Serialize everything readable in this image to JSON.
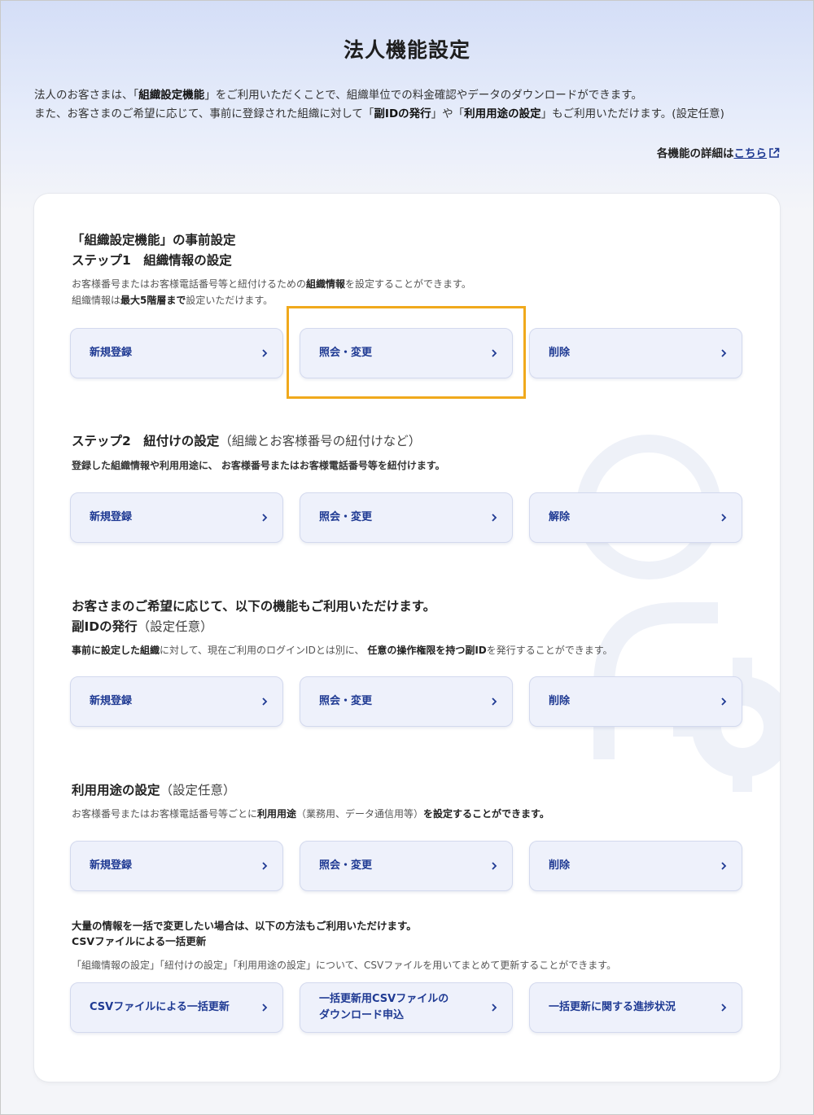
{
  "page": {
    "title": "法人機能設定",
    "intro": {
      "l1a": "法人のお客さまは、「",
      "l1b": "組織設定機能",
      "l1c": "」をご利用いただくことで、組織単位での料金確認やデータのダウンロードができます。",
      "l2a": "また、お客さまのご希望に応じて、事前に登録された組織に対して「",
      "l2b": "副IDの発行",
      "l2c": "」や「",
      "l2d": "利用用途の設定",
      "l2e": "」もご利用いただけます。(設定任意)"
    },
    "detail": {
      "text": "各機能の詳細は",
      "link": "こちら",
      "icon": "external-link-icon"
    }
  },
  "colors": {
    "accent": "#1f3a93",
    "button_bg": "#eef1fb",
    "highlight": "#f0a91c"
  },
  "sections": {
    "step1": {
      "pre": "「組織設定機能」の事前設定",
      "heading": "ステップ1　組織情報の設定",
      "d1a": "お客様番号またはお客様電話番号等と紐付けるための",
      "d1b": "組織情報",
      "d1c": "を設定することができます。",
      "d2a": "組織情報は",
      "d2b": "最大5階層まで",
      "d2c": "設定いただけます。",
      "buttons": [
        "新規登録",
        "照会・変更",
        "削除"
      ]
    },
    "step2": {
      "heading": "ステップ2　紐付けの設定",
      "sub": "（組織とお客様番号の紐付けなど）",
      "desc": "登録した組織情報や利用用途に、 お客様番号またはお客様電話番号等を紐付けます。",
      "buttons": [
        "新規登録",
        "照会・変更",
        "解除"
      ]
    },
    "subid": {
      "pre": "お客さまのご希望に応じて、以下の機能もご利用いただけます。",
      "heading": "副IDの発行",
      "sub": "（設定任意）",
      "da": "事前に設定した組織",
      "db": "に対して、現在ご利用のログインIDとは別に、",
      "dc": "任意の操作権限を持つ副ID",
      "dd": "を発行することができます。",
      "buttons": [
        "新規登録",
        "照会・変更",
        "削除"
      ]
    },
    "usage": {
      "heading": "利用用途の設定",
      "sub": "（設定任意）",
      "da": "お客様番号またはお客様電話番号等ごとに",
      "db": "利用用途",
      "dc": "（業務用、データ通信用等）",
      "dd": "を設定することができます。",
      "buttons": [
        "新規登録",
        "照会・変更",
        "削除"
      ]
    },
    "csv": {
      "pre": "大量の情報を一括で変更したい場合は、以下の方法もご利用いただけます。",
      "heading": "CSVファイルによる一括更新",
      "desc": "「組織情報の設定」「紐付けの設定」「利用用途の設定」について、CSVファイルを用いてまとめて更新することができます。",
      "buttons": [
        "CSVファイルによる一括更新",
        "一括更新用CSVファイルの\nダウンロード申込",
        "一括更新に関する進捗状況"
      ]
    }
  }
}
